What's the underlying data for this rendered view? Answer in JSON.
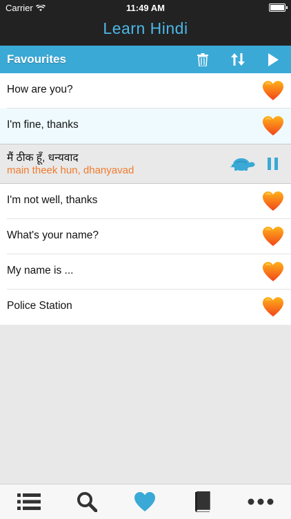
{
  "status": {
    "carrier": "Carrier",
    "time": "11:49 AM",
    "battery_level": 1.0
  },
  "app": {
    "title": "Learn Hindi"
  },
  "toolbar": {
    "label": "Favourites"
  },
  "colors": {
    "accent": "#3aa9d6",
    "title": "#4db8e8",
    "romanization": "#f07b2d",
    "heart": "#f45a1a"
  },
  "phrases": [
    {
      "text": "How are you?"
    },
    {
      "text": "I'm fine, thanks"
    },
    {
      "native": "मैं ठीक हूँ, धन्यवाद",
      "roman": "main theek hun, dhanyavad"
    },
    {
      "text": "I'm not well, thanks"
    },
    {
      "text": "What's your name?"
    },
    {
      "text": "My name is ..."
    },
    {
      "text": "Police Station"
    }
  ],
  "tabs": [
    {
      "name": "list-icon"
    },
    {
      "name": "search-icon"
    },
    {
      "name": "heart-icon",
      "selected": true
    },
    {
      "name": "book-icon"
    },
    {
      "name": "more-icon"
    }
  ]
}
